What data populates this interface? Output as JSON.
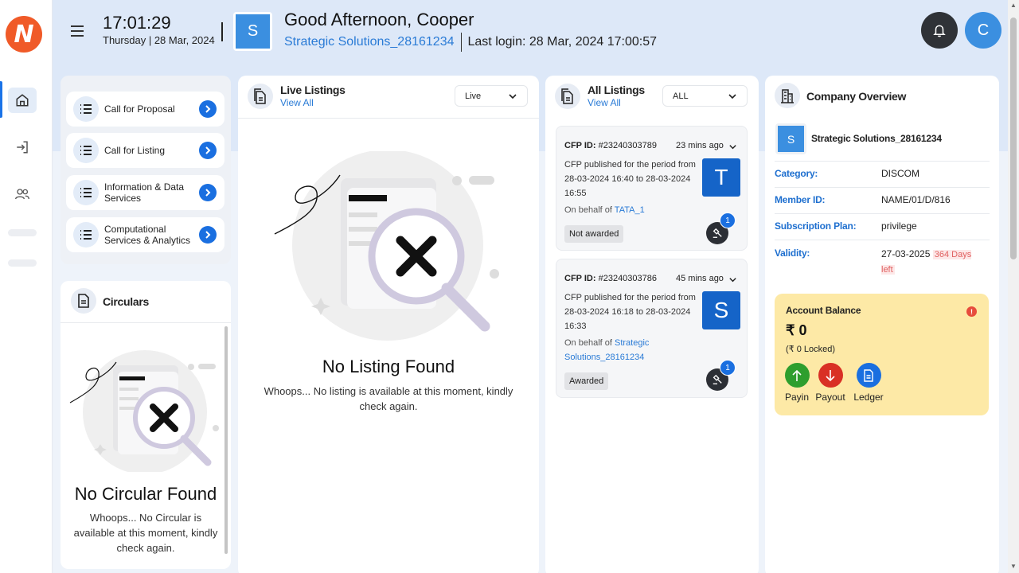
{
  "brand": {
    "logo_letter": "N"
  },
  "header": {
    "time": "17:01:29",
    "day": "Thursday",
    "date": "28 Mar, 2024",
    "org_avatar_letter": "S",
    "greeting": "Good Afternoon, Cooper",
    "org_name": "Strategic Solutions_28161234",
    "last_login": "Last login: 28 Mar, 2024 17:00:57",
    "user_avatar_letter": "C"
  },
  "quick_links": [
    {
      "label": "Call for Proposal"
    },
    {
      "label": "Call for Listing"
    },
    {
      "label": "Information & Data Services"
    },
    {
      "label": "Computational Services & Analytics"
    }
  ],
  "circulars": {
    "title": "Circulars",
    "empty_title": "No Circular Found",
    "empty_sub": "Whoops... No Circular is available at this moment, kindly check again."
  },
  "live_listings": {
    "title": "Live Listings",
    "view_all": "View All",
    "filter": "Live",
    "empty_title": "No Listing Found",
    "empty_sub": "Whoops... No listing is available at this moment, kindly check again."
  },
  "all_listings": {
    "title": "All Listings",
    "view_all": "View All",
    "filter": "ALL",
    "items": [
      {
        "cfp_label": "CFP ID:",
        "cfp_id": "#23240303789",
        "ago": "23 mins ago",
        "desc": "CFP published for the period from 28-03-2024 16:40 to 28-03-2024 16:55",
        "behalf_prefix": "On behalf of",
        "behalf_name": "TATA_1",
        "avatar_letter": "T",
        "status": "Not awarded",
        "count": "1"
      },
      {
        "cfp_label": "CFP ID:",
        "cfp_id": "#23240303786",
        "ago": "45 mins ago",
        "desc": "CFP published for the period from 28-03-2024 16:18 to 28-03-2024 16:33",
        "behalf_prefix": "On behalf of",
        "behalf_name": "Strategic Solutions_28161234",
        "avatar_letter": "S",
        "status": "Awarded",
        "count": "1"
      }
    ]
  },
  "company": {
    "title": "Company Overview",
    "avatar_letter": "S",
    "name": "Strategic Solutions_28161234",
    "rows": [
      {
        "key": "Category:",
        "value": "DISCOM"
      },
      {
        "key": "Member ID:",
        "value": "NAME/01/D/816"
      },
      {
        "key": "Subscription Plan:",
        "value": "privilege"
      },
      {
        "key": "Validity:",
        "value": "27-03-2025",
        "extra": "364 Days left"
      }
    ],
    "balance": {
      "title": "Account Balance",
      "info": "!",
      "amount": "₹ 0",
      "locked": "(₹ 0 Locked)",
      "actions": [
        {
          "label": "Payin",
          "color": "#2e9e2e"
        },
        {
          "label": "Payout",
          "color": "#d93025"
        },
        {
          "label": "Ledger",
          "color": "#1a6fe0"
        }
      ]
    }
  }
}
